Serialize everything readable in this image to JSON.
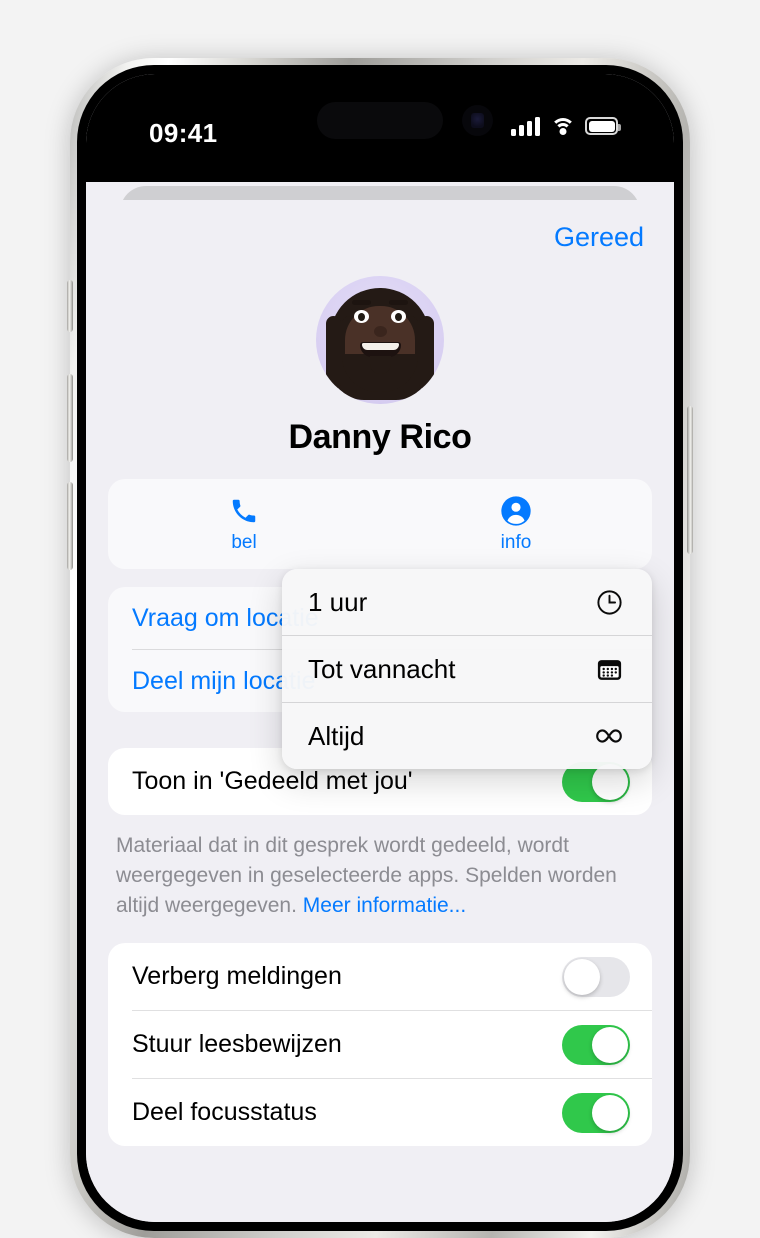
{
  "status_bar": {
    "time": "09:41",
    "cellular_icon": "cellular-bars-icon",
    "wifi_icon": "wifi-icon",
    "battery_icon": "battery-full-icon"
  },
  "sheet": {
    "done_label": "Gereed",
    "contact_name": "Danny Rico",
    "avatar_icon": "memoji-avatar"
  },
  "actions": [
    {
      "label": "bel",
      "icon": "phone-icon"
    },
    {
      "label": "info",
      "icon": "person-circle-icon"
    }
  ],
  "location": {
    "rows": [
      {
        "label": "Vraag om locatie"
      },
      {
        "label": "Deel mijn locatie"
      }
    ]
  },
  "shared_with_you": {
    "toggle_label": "Toon in 'Gedeeld met jou'",
    "toggle_on": true,
    "footnote_text": "Materiaal dat in dit gesprek wordt gedeeld, wordt weergegeven in geselecteerde apps. Spelden worden altijd weergegeven. ",
    "footnote_link": "Meer informatie..."
  },
  "settings_rows": [
    {
      "label": "Verberg meldingen",
      "on": false
    },
    {
      "label": "Stuur leesbewijzen",
      "on": true
    },
    {
      "label": "Deel focusstatus",
      "on": true
    }
  ],
  "popup_menu": {
    "items": [
      {
        "label": "1 uur",
        "icon": "clock-icon"
      },
      {
        "label": "Tot vannacht",
        "icon": "calendar-icon"
      },
      {
        "label": "Altijd",
        "icon": "infinity-icon"
      }
    ]
  },
  "colors": {
    "accent_blue": "#047aff",
    "toggle_green": "#30c84b",
    "sheet_background": "#f0eff4",
    "footnote_grey": "#8c8c92"
  }
}
